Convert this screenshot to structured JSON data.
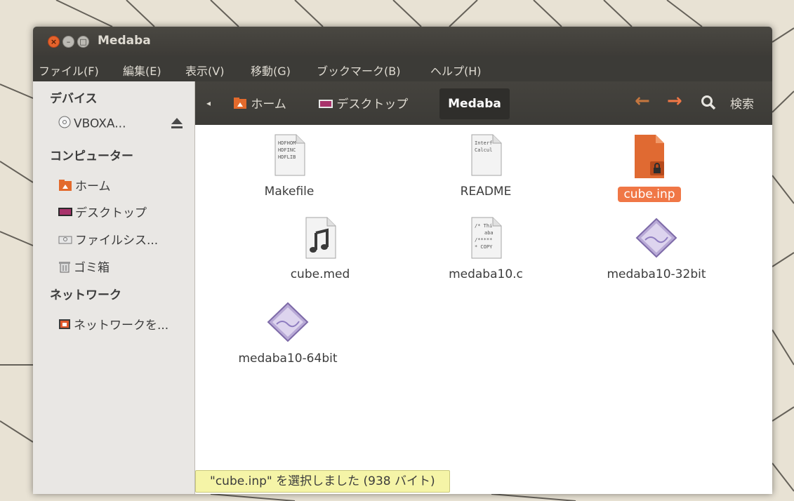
{
  "window": {
    "title": "Medaba"
  },
  "menubar": {
    "items": [
      "ファイル(F)",
      "編集(E)",
      "表示(V)",
      "移動(G)",
      "ブックマーク(B)",
      "ヘルプ(H)"
    ]
  },
  "sidebar": {
    "devices_heading": "デバイス",
    "device_items": [
      {
        "label": "VBOXA...",
        "icon": "disc-icon"
      }
    ],
    "computer_heading": "コンピューター",
    "computer_items": [
      {
        "label": "ホーム",
        "icon": "home-folder-icon"
      },
      {
        "label": "デスクトップ",
        "icon": "desktop-icon"
      },
      {
        "label": "ファイルシス...",
        "icon": "drive-icon"
      },
      {
        "label": "ゴミ箱",
        "icon": "trash-icon"
      }
    ],
    "network_heading": "ネットワーク",
    "network_items": [
      {
        "label": "ネットワークを...",
        "icon": "network-icon"
      }
    ]
  },
  "toolbar": {
    "breadcrumbs": [
      "ホーム",
      "デスクトップ"
    ],
    "current": "Medaba",
    "search_label": "検索"
  },
  "files": [
    {
      "name": "Makefile",
      "icon": "text-file-icon",
      "preview": [
        "HDFHOM",
        "HDFINC",
        "HDFLIB"
      ]
    },
    {
      "name": "README",
      "icon": "text-file-icon",
      "preview": [
        "Interf",
        "Calcul"
      ]
    },
    {
      "name": "cube.inp",
      "icon": "locked-file-icon",
      "selected": true
    },
    {
      "name": "cube.med",
      "icon": "audio-file-icon"
    },
    {
      "name": "medaba10.c",
      "icon": "c-source-file-icon",
      "preview": [
        "/* Thi",
        "aba",
        "/*****",
        "* COPY"
      ]
    },
    {
      "name": "medaba10-32bit",
      "icon": "executable-icon"
    },
    {
      "name": "medaba10-64bit",
      "icon": "executable-icon"
    }
  ],
  "status": {
    "text": "\"cube.inp\" を選択しました (938 バイト)"
  },
  "colors": {
    "accent": "#f07746",
    "titlebar": "#3c3b37"
  }
}
